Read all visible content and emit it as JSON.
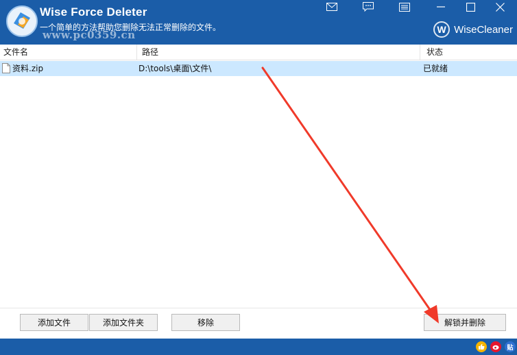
{
  "window": {
    "title": "Wise Force Deleter",
    "subtitle": "一个简单的方法帮助您删除无法正常删除的文件。",
    "watermark": "www.pc0359.cn",
    "brand": {
      "badge": "W",
      "name": "WiseCleaner"
    },
    "controls": [
      "mail-icon",
      "feedback-icon",
      "menu-icon",
      "minimize-icon",
      "maximize-icon",
      "close-icon"
    ]
  },
  "table": {
    "columns": [
      "文件名",
      "路径",
      "状态"
    ],
    "rows": [
      {
        "name": "资料.zip",
        "path": "D:\\tools\\桌面\\文件\\",
        "status": "已就绪"
      }
    ]
  },
  "buttons": {
    "add_file": "添加文件",
    "add_folder": "添加文件夹",
    "remove": "移除",
    "unlock_delete": "解锁并删除"
  },
  "statusbar": {
    "icons": [
      "thumbs-up-icon",
      "weibo-icon",
      "tieba-icon"
    ],
    "tieba_label": "贴"
  },
  "colors": {
    "title_bar": "#1b5da8",
    "row_selected": "#cce8ff",
    "annotation_arrow": "#f03a2a"
  }
}
